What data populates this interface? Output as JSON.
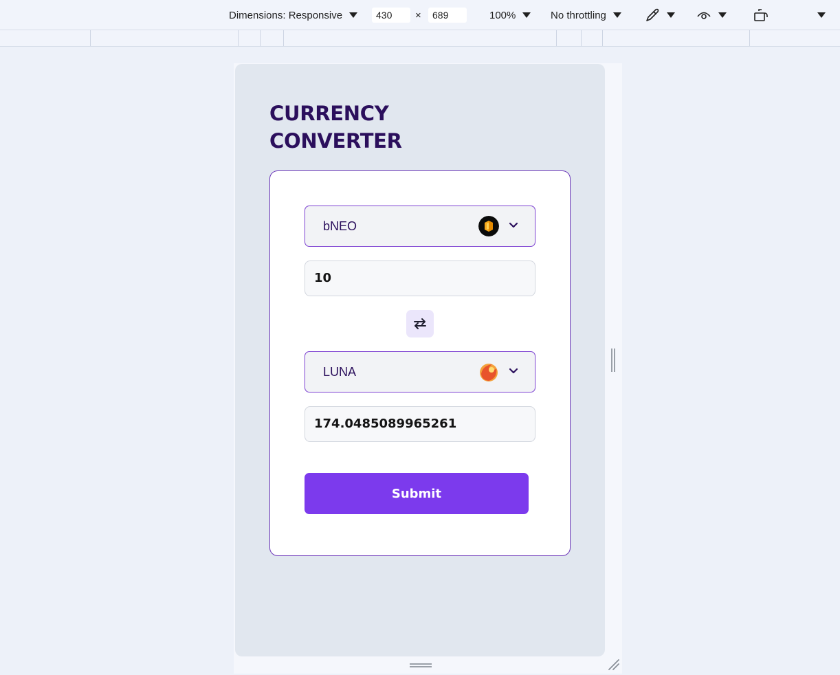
{
  "devtools": {
    "dimensions_label": "Dimensions: Responsive",
    "width": "430",
    "times": "×",
    "height": "689",
    "zoom": "100%",
    "throttling": "No throttling"
  },
  "page": {
    "title_line1": "CURRENCY",
    "title_line2": "CONVERTER"
  },
  "converter": {
    "from_currency": "bNEO",
    "from_icon": "bneo-coin-icon",
    "from_amount": "10",
    "to_currency": "LUNA",
    "to_icon": "luna-coin-icon",
    "to_amount": "174.0485089965261",
    "submit_label": "Submit"
  },
  "colors": {
    "accent": "#7c3aed",
    "title": "#2b0f5c",
    "card_border": "#6b35b8"
  }
}
